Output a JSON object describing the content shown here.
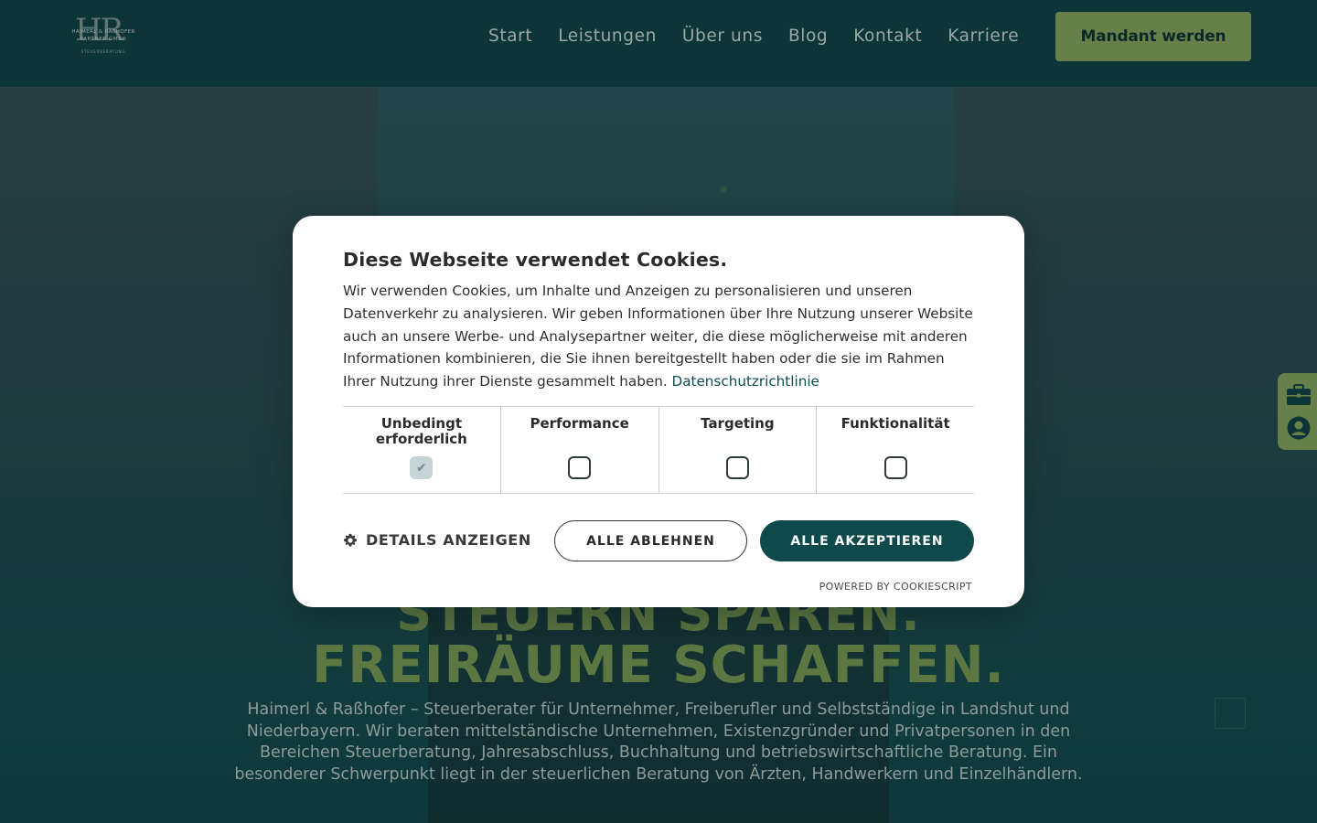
{
  "header": {
    "logo": {
      "mark": "HR",
      "line1": "HAIMERL & RAßHOFER",
      "line2": "PARTNER GMBH",
      "line3": "STEUERBERATUNG"
    },
    "nav": [
      "Start",
      "Leistungen",
      "Über uns",
      "Blog",
      "Kontakt",
      "Karriere"
    ],
    "cta_label": "Mandant werden"
  },
  "hero": {
    "headline_line1": "STEUERN SPAREN.",
    "headline_line2": "FREIRÄUME SCHAFFEN.",
    "text": "Haimerl & Raßhofer – Steuerberater für Unternehmer, Freiberufler und Selbstständige in Landshut und Niederbayern. Wir beraten mittelständische Unternehmen, Existenzgründer und Privatpersonen in den Bereichen Steuerberatung, Jahresabschluss, Buchhaltung und betriebswirtschaftliche Beratung. Ein besonderer Schwerpunkt liegt in der steuerlichen Beratung von Ärzten, Handwerkern und Einzelhändlern."
  },
  "side_dock": {
    "icons": [
      "briefcase-icon",
      "user-icon"
    ]
  },
  "cookie_banner": {
    "title": "Diese Webseite verwendet Cookies.",
    "body": "Wir verwenden Cookies, um Inhalte und Anzeigen zu personalisieren und unseren Datenverkehr zu analysieren. Wir geben Informationen über Ihre Nutzung unserer Website auch an unsere Werbe- und Analysepartner weiter, die diese möglicherweise mit anderen Informationen kombinieren, die Sie ihnen bereitgestellt haben oder die sie im Rahmen Ihrer Nutzung ihrer Dienste gesammelt haben.",
    "privacy_link": "Datenschutzrichtlinie",
    "categories": [
      {
        "label": "Unbedingt erforderlich",
        "checked": true,
        "disabled": true
      },
      {
        "label": "Performance",
        "checked": false
      },
      {
        "label": "Targeting",
        "checked": false
      },
      {
        "label": "Funktionalität",
        "checked": false
      }
    ],
    "details_label": "DETAILS ANZEIGEN",
    "reject_label": "ALLE ABLEHNEN",
    "accept_label": "ALLE AKZEPTIEREN",
    "powered_by": "POWERED BY COOKIESCRIPT"
  },
  "colors": {
    "header_bg": "#0e3b3c",
    "accent_green": "#7c9552",
    "headline_green": "#6f8c4a",
    "accept_button": "#0e4a4c"
  }
}
